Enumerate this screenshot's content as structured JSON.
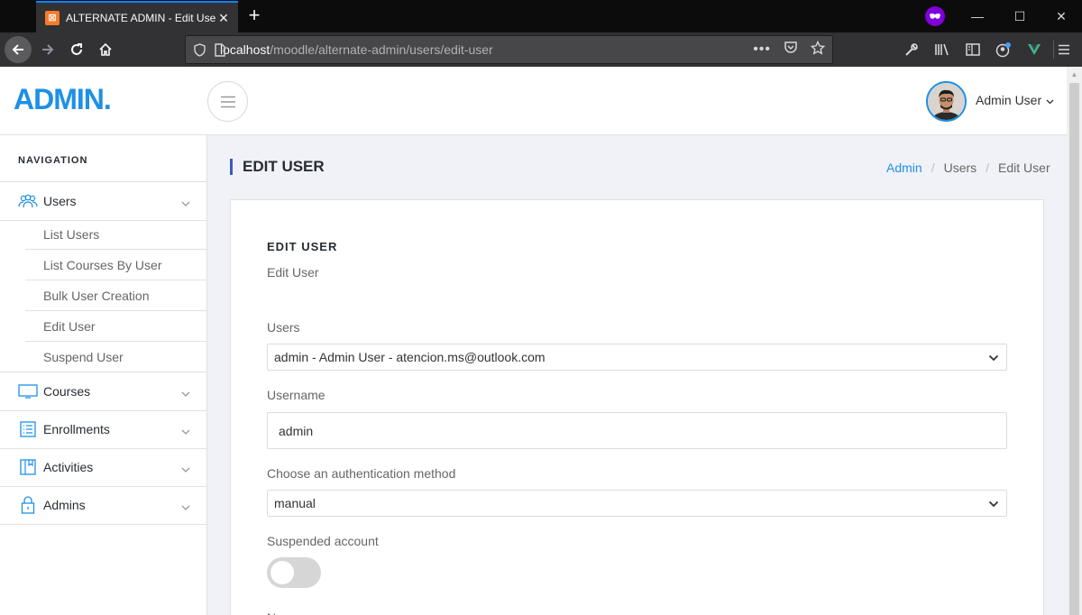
{
  "browser": {
    "tab_title": "ALTERNATE ADMIN - Edit User",
    "url_host": "localhost",
    "url_path": "/moodle/alternate-admin/users/edit-user"
  },
  "header": {
    "logo": "ADMIN.",
    "user_name": "Admin User"
  },
  "sidebar": {
    "heading": "NAVIGATION",
    "users_label": "Users",
    "users_sub": [
      "List Users",
      "List Courses By User",
      "Bulk User Creation",
      "Edit User",
      "Suspend User"
    ],
    "items": [
      "Courses",
      "Enrollments",
      "Activities",
      "Admins"
    ]
  },
  "page": {
    "title": "EDIT USER",
    "breadcrumb": [
      "Admin",
      "Users",
      "Edit User"
    ]
  },
  "form": {
    "title": "EDIT USER",
    "subtitle": "Edit User",
    "users_label": "Users",
    "users_value": "admin - Admin User - atencion.ms@outlook.com",
    "username_label": "Username",
    "username_value": "admin",
    "auth_label": "Choose an authentication method",
    "auth_value": "manual",
    "suspended_label": "Suspended account",
    "suspended": false,
    "next_label_partial": "N"
  },
  "colors": {
    "accent": "#1e90e6",
    "title_bar": "#3d5cbe",
    "toggle_off": "#d6d6d6"
  }
}
